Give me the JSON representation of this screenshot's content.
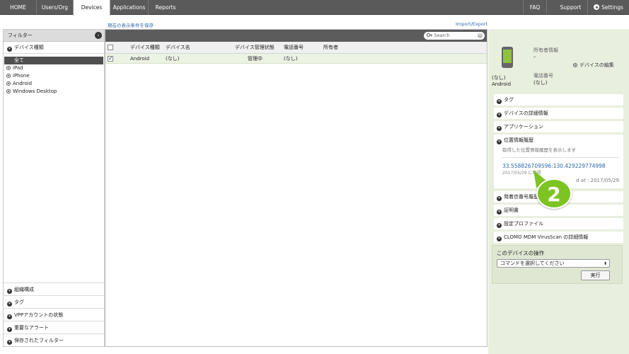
{
  "nav": {
    "tabs": [
      "HOME",
      "Users/Org",
      "Devices",
      "Applications",
      "Reports"
    ],
    "right": [
      "FAQ",
      "Support",
      "Settings"
    ]
  },
  "links": {
    "save_filter": "現在の表示条件を保存",
    "import_export": "Import/Export"
  },
  "filter": {
    "title": "フィルター",
    "device_type_label": "デバイス種類",
    "items": [
      "全て",
      "iPad",
      "iPhone",
      "Android",
      "Windows Desktop"
    ],
    "bottom_sections": [
      "組織構成",
      "タグ",
      "VPPアカウントの状態",
      "重要なアラート",
      "保存されたフィルター"
    ]
  },
  "search": {
    "placeholder": "Search"
  },
  "table": {
    "headers": [
      "デバイス種類",
      "デバイス名",
      "デバイス管理状態",
      "電話番号",
      "所有者"
    ],
    "rows": [
      {
        "device_type": "Android",
        "device_name": "(なし)",
        "status": "管理中",
        "phone": "(なし)",
        "owner": ""
      }
    ]
  },
  "device_panel": {
    "name": "(なし)",
    "type": "Android",
    "owner_label": "所有者情報",
    "owner_value": "–",
    "edit_link": "デバイスの編集",
    "phone_label": "電話番号",
    "phone_value": "(なし)",
    "sections": [
      "タグ",
      "デバイスの詳細情報",
      "アプリケーション",
      "位置情報履歴",
      "発着信番号履歴",
      "証明書",
      "設定プロファイル",
      "CLOMO MDM VirusScan の詳細情報"
    ],
    "location": {
      "desc": "取得した位置情報履歴を表示します",
      "coords": "33.558826709596:130.429229774998",
      "date": "2017/05/29 に取得",
      "updated": "d at : 2017/05/29"
    },
    "operations_title": "このデバイスの操作",
    "command_select": "コマンドを選択してください",
    "run_button": "実行"
  },
  "callout_number": "2",
  "colors": {
    "nav_bg": "#5a5a5a",
    "row_selected": "#edf3e4",
    "right_bg": "#e9efdf",
    "callout": "#7dc322",
    "link": "#2d6aa8"
  }
}
